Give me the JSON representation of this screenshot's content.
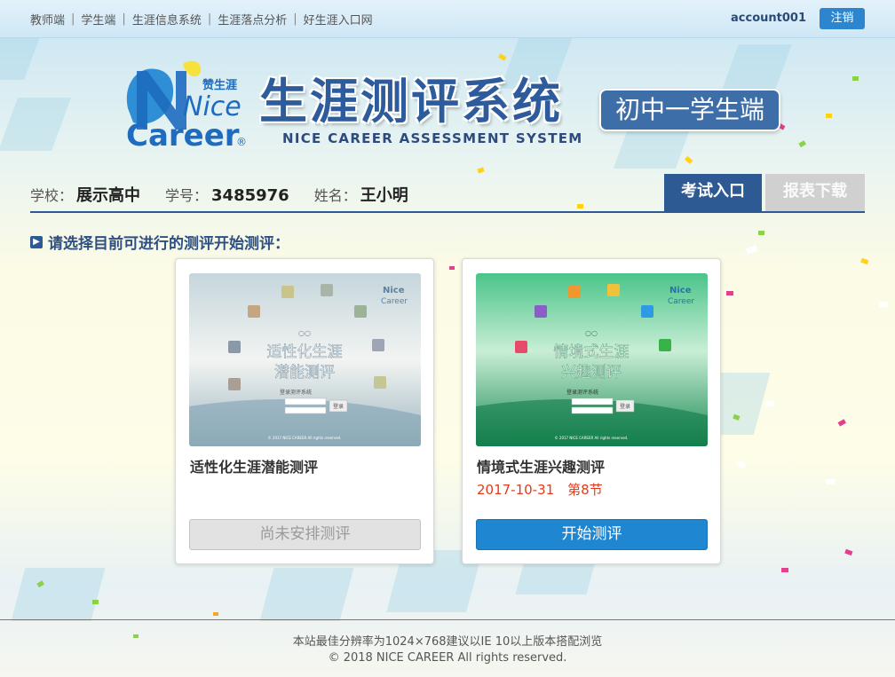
{
  "topnav": {
    "links": [
      "教师端",
      "学生端",
      "生涯信息系统",
      "生涯落点分析",
      "好生涯入口网"
    ],
    "account": "account001",
    "logout": "注销"
  },
  "header": {
    "logo_top": "赞生涯",
    "logo_nice": "Nice",
    "logo_career": "Career",
    "title": "生涯测评系统",
    "subtitle": "NICE CAREER ASSESSMENT SYSTEM",
    "grade": "初中一学生端"
  },
  "student": {
    "school_label": "学校：",
    "school": "展示高中",
    "id_label": "学号：",
    "id": "3485976",
    "name_label": "姓名：",
    "name": "王小明"
  },
  "tabs": {
    "exam": "考试入口",
    "report": "报表下载"
  },
  "section_heading": "请选择目前可进行的测评开始测评：",
  "cards": [
    {
      "title": "适性化生涯潜能测评",
      "date": "",
      "button": "尚未安排测评",
      "thumb_title": "适性化生涯潜能测评",
      "thumb_line1": "适性化生涯",
      "thumb_line2": "潜能测评",
      "thumb_login": "登录测评系统",
      "thumb_btn": "登录",
      "thumb_footer": "© 2017 NICE CAREER All rights reserved."
    },
    {
      "title": "情境式生涯兴趣测评",
      "date": "2017-10-31　第8节",
      "button": "开始测评",
      "thumb_title": "情境式生涯兴趣测评",
      "thumb_line1": "情境式生涯",
      "thumb_line2": "兴趣测评",
      "thumb_login": "登录测评系统",
      "thumb_btn": "登录",
      "thumb_footer": "© 2017 NICE CAREER All rights reserved."
    }
  ],
  "footer": {
    "line1": "本站最佳分辨率为1024×768建议以IE 10以上版本搭配浏览",
    "line2": "© 2018 NICE CAREER All rights reserved."
  },
  "colors": {
    "primary": "#2e5a94",
    "button_blue": "#1f86d2",
    "date_red": "#e23b1a",
    "disabled_gray": "#e2e2e2"
  }
}
